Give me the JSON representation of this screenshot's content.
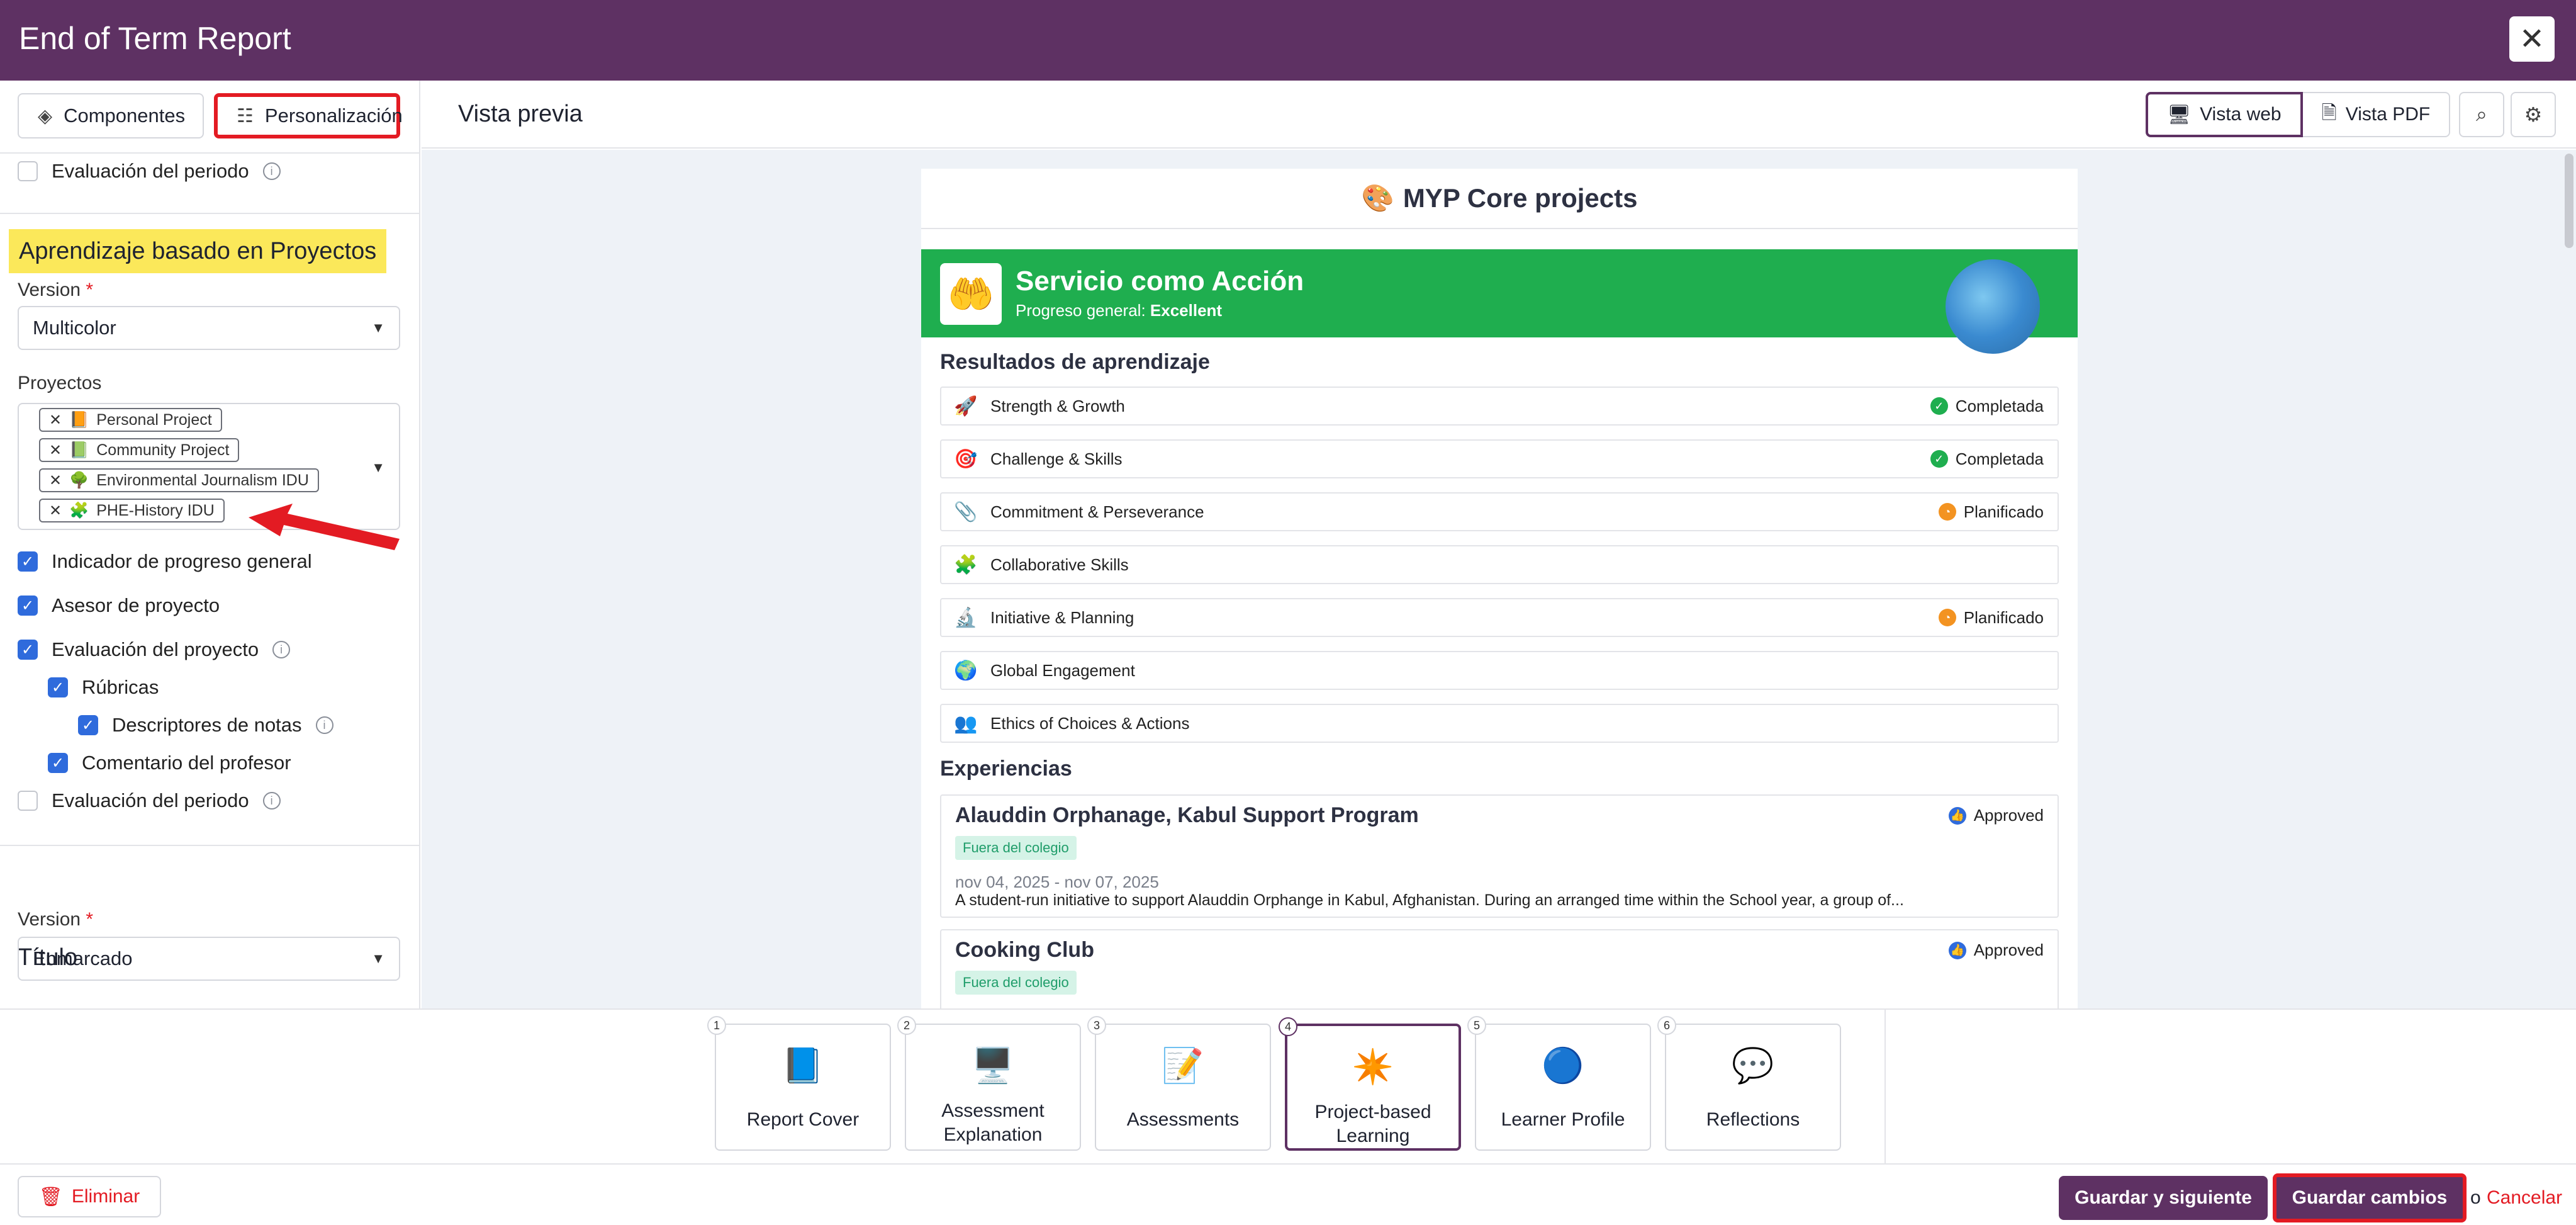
{
  "header": {
    "title": "End of Term Report",
    "close_icon": "close-icon"
  },
  "sidebar": {
    "tabs": [
      {
        "label": "Componentes",
        "icon": "layers-icon"
      },
      {
        "label": "Personalización",
        "icon": "sliders-icon"
      }
    ],
    "period_eval_top": {
      "label": "Evaluación del periodo",
      "checked": false
    },
    "section_title": "Aprendizaje basado en Proyectos",
    "version_label": "Version",
    "version_value": "Multicolor",
    "projects_label": "Proyectos",
    "projects": [
      {
        "label": "Personal Project",
        "icon": "📙"
      },
      {
        "label": "Community Project",
        "icon": "📗"
      },
      {
        "label": "Environmental Journalism IDU",
        "icon": "🌳"
      },
      {
        "label": "PHE-History IDU",
        "icon": "🧩"
      }
    ],
    "options": [
      {
        "label": "Indicador de progreso general",
        "checked": true
      },
      {
        "label": "Asesor de proyecto",
        "checked": true
      },
      {
        "label": "Evaluación del proyecto",
        "checked": true
      },
      {
        "label": "Rúbricas",
        "checked": true
      },
      {
        "label": "Descriptores de notas",
        "checked": true
      },
      {
        "label": "Comentario del profesor",
        "checked": true
      },
      {
        "label": "Evaluación del periodo",
        "checked": false
      }
    ],
    "title_section": "Título",
    "title_version_label": "Version",
    "title_version_value": "Enmarcado"
  },
  "preview": {
    "title": "Vista previa",
    "view_web": "Vista web",
    "view_pdf": "Vista PDF",
    "doc_title": "MYP Core projects",
    "banner_title": "Servicio como Acción",
    "banner_progress_label": "Progreso general:",
    "banner_progress_value": "Excellent",
    "outcomes_heading": "Resultados de aprendizaje",
    "outcomes": [
      {
        "label": "Strength & Growth",
        "icon": "🚀",
        "status": "Completada",
        "status_color": "#1fae4f"
      },
      {
        "label": "Challenge & Skills",
        "icon": "🎯",
        "status": "Completada",
        "status_color": "#1fae4f"
      },
      {
        "label": "Commitment & Perseverance",
        "icon": "📎",
        "status": "Planificado",
        "status_color": "#f39321"
      },
      {
        "label": "Collaborative Skills",
        "icon": "🧩",
        "status": "",
        "status_color": ""
      },
      {
        "label": "Initiative & Planning",
        "icon": "🔬",
        "status": "Planificado",
        "status_color": "#f39321"
      },
      {
        "label": "Global Engagement",
        "icon": "🌍",
        "status": "",
        "status_color": ""
      },
      {
        "label": "Ethics of Choices & Actions",
        "icon": "👥",
        "status": "",
        "status_color": ""
      }
    ],
    "experiences_heading": "Experiencias",
    "experiences": [
      {
        "title": "Alauddin Orphanage, Kabul Support Program",
        "status": "Approved",
        "badge": "Fuera del colegio",
        "date": "nov 04, 2025 - nov 07, 2025",
        "desc": "A student-run initiative to support Alauddin Orphange in Kabul, Afghanistan. During an arranged time within the School year, a group of..."
      },
      {
        "title": "Cooking Club",
        "status": "Approved",
        "badge": "Fuera del colegio",
        "date": "",
        "desc": ""
      }
    ]
  },
  "stepper": [
    {
      "num": "1",
      "label": "Report Cover",
      "icon": "📘"
    },
    {
      "num": "2",
      "label": "Assessment Explanation",
      "icon": "🖥️"
    },
    {
      "num": "3",
      "label": "Assessments",
      "icon": "📝"
    },
    {
      "num": "4",
      "label": "Project-based Learning",
      "icon": "✴️"
    },
    {
      "num": "5",
      "label": "Learner Profile",
      "icon": "🔵"
    },
    {
      "num": "6",
      "label": "Reflections",
      "icon": "💬"
    }
  ],
  "footer": {
    "delete_label": "Eliminar",
    "save_next_label": "Guardar y siguiente",
    "save_label": "Guardar cambios",
    "or_label": "o",
    "cancel_label": "Cancelar"
  }
}
